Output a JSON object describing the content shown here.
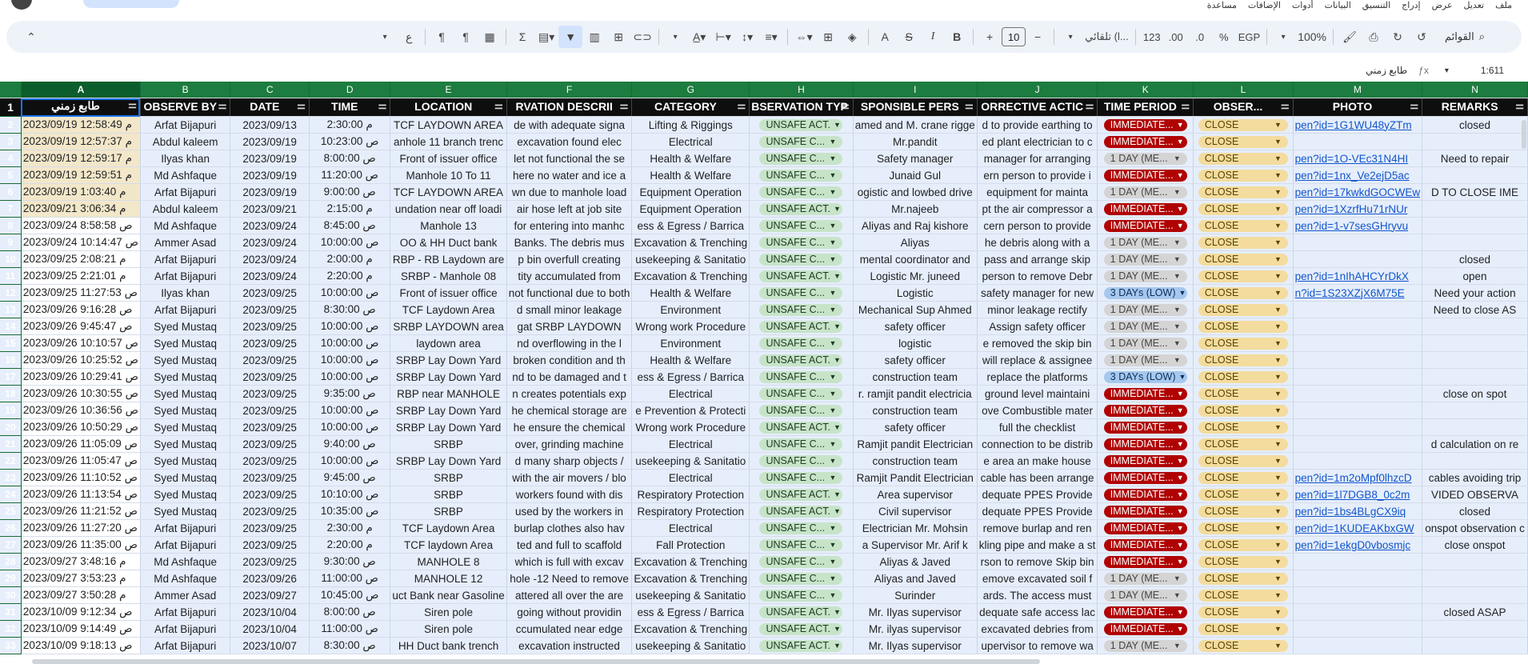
{
  "menu": [
    "ملف",
    "تعديل",
    "عرض",
    "إدراج",
    "التنسيق",
    "البيانات",
    "أدوات",
    "الإضافات",
    "مساعدة"
  ],
  "toolbar": {
    "search": "القوائم",
    "zoom": "100%",
    "currency": "EGP",
    "percent": "%",
    "dec_less": ".0",
    "dec_more": ".00",
    "num_format": "123",
    "font": "تلقائي (l...",
    "font_size": "10"
  },
  "formula_bar": {
    "name_box": "1:611",
    "content": "طابع زمني"
  },
  "columns": [
    "A",
    "B",
    "C",
    "D",
    "E",
    "F",
    "G",
    "H",
    "I",
    "J",
    "K",
    "L",
    "M",
    "N"
  ],
  "headers": [
    "طابع زمني",
    "OBSERVE BY",
    "DATE",
    "TIME",
    "LOCATION",
    "RVATION DESCRII",
    "CATEGORY",
    "BSERVATION TYP",
    "SPONSIBLE PERS",
    "ORRECTIVE ACTIC",
    "TIME PERIOD",
    "OBSER...",
    "PHOTO",
    "REMARKS"
  ],
  "rows": [
    {
      "n": "2",
      "ts": "م 12:58:49 2023/09/19",
      "by": "Arfat Bijapuri",
      "date": "2023/09/13",
      "time": "2:30:00 م",
      "loc": "TCF LAYDOWN AREA",
      "desc": "de with adequate signa",
      "cat": "Lifting & Riggings",
      "type": "UNSAFE ACT.",
      "resp": "amed and M. crane rigge",
      "corr": "d to provide earthing to",
      "period": "IMMEDIATE...",
      "status": "CLOSE",
      "photo": "pen?id=1G1WU48yZTm",
      "rem": "closed"
    },
    {
      "n": "3",
      "ts": "م 12:57:37 2023/09/19",
      "by": "Abdul kaleem",
      "date": "2023/09/19",
      "time": "10:23:00 ص",
      "loc": "anhole 11 branch trenc",
      "desc": "excavation found elec",
      "cat": "Electrical",
      "type": "UNSAFE C...",
      "resp": "Mr.pandit",
      "corr": "ed plant electrician to c",
      "period": "IMMEDIATE...",
      "status": "CLOSE",
      "photo": "",
      "rem": ""
    },
    {
      "n": "4",
      "ts": "م 12:59:17 2023/09/19",
      "by": "Ilyas khan",
      "date": "2023/09/19",
      "time": "8:00:00 ص",
      "loc": "Front of issuer office",
      "desc": "let not functional the se",
      "cat": "Health & Welfare",
      "type": "UNSAFE C...",
      "resp": "Safety manager",
      "corr": "manager for arranging",
      "period": "1 DAY (ME...",
      "status": "CLOSE",
      "photo": "pen?id=1O-VEc31N4HI",
      "rem": "Need to repair"
    },
    {
      "n": "5",
      "ts": "م 12:59:51 2023/09/19",
      "by": "Md Ashfaque",
      "date": "2023/09/19",
      "time": "11:20:00 ص",
      "loc": "Manhole 10 To 11",
      "desc": "here no water and ice a",
      "cat": "Health & Welfare",
      "type": "UNSAFE C...",
      "resp": "Junaid Gul",
      "corr": "ern person to provide i",
      "period": "IMMEDIATE...",
      "status": "CLOSE",
      "photo": "pen?id=1nx_Ve2ejD5ac",
      "rem": ""
    },
    {
      "n": "6",
      "ts": "م 1:03:40 2023/09/19",
      "by": "Arfat Bijapuri",
      "date": "2023/09/19",
      "time": "9:00:00 ص",
      "loc": "TCF LAYDOWN AREA",
      "desc": "wn due to manhole load",
      "cat": "Equipment Operation",
      "type": "UNSAFE C...",
      "resp": "ogistic and lowbed drive",
      "corr": "equipment for mainta",
      "period": "1 DAY (ME...",
      "status": "CLOSE",
      "photo": "pen?id=17kwkdGOCWEw",
      "rem": "D TO CLOSE IME"
    },
    {
      "n": "7",
      "ts": "م 3:06:34 2023/09/21",
      "by": "Abdul kaleem",
      "date": "2023/09/21",
      "time": "2:15:00 م",
      "loc": "undation near off loadi",
      "desc": "air hose left at job site",
      "cat": "Equipment Operation",
      "type": "UNSAFE ACT.",
      "resp": "Mr.najeeb",
      "corr": "pt the air compressor a",
      "period": "IMMEDIATE...",
      "status": "CLOSE",
      "photo": "pen?id=1XzrfHu71rNUr",
      "rem": ""
    },
    {
      "n": "8",
      "ts": "ص 8:58:58 2023/09/24",
      "by": "Md Ashfaque",
      "date": "2023/09/24",
      "time": "8:45:00 ص",
      "loc": "Manhole 13",
      "desc": "for entering into manhc",
      "cat": "ess & Egress / Barrica",
      "type": "UNSAFE C...",
      "resp": "Aliyas and Raj kishore",
      "corr": "cern person to provide",
      "period": "IMMEDIATE...",
      "status": "CLOSE",
      "photo": "pen?id=1-v7sesGHryvu",
      "rem": ""
    },
    {
      "n": "9",
      "ts": "ص 10:14:47 2023/09/24",
      "by": "Ammer Asad",
      "date": "2023/09/24",
      "time": "10:00:00 ص",
      "loc": "OO & HH Duct bank",
      "desc": "Banks. The debris mus",
      "cat": "Excavation & Trenching",
      "type": "UNSAFE C...",
      "resp": "Aliyas",
      "corr": "he debris along with a",
      "period": "1 DAY (ME...",
      "status": "CLOSE",
      "photo": "",
      "rem": ""
    },
    {
      "n": "10",
      "ts": "م 2:08:21 2023/09/25",
      "by": "Arfat Bijapuri",
      "date": "2023/09/24",
      "time": "2:00:00 م",
      "loc": "RBP - RB Laydown are",
      "desc": "p bin overfull creating",
      "cat": "usekeeping & Sanitatio",
      "type": "UNSAFE C...",
      "resp": "mental coordinator and",
      "corr": "pass and arrange skip",
      "period": "1 DAY (ME...",
      "status": "CLOSE",
      "photo": "",
      "rem": "closed"
    },
    {
      "n": "11",
      "ts": "م 2:21:01 2023/09/25",
      "by": "Arfat Bijapuri",
      "date": "2023/09/24",
      "time": "2:20:00 م",
      "loc": "SRBP - Manhole 08",
      "desc": "tity accumulated from",
      "cat": "Excavation & Trenching",
      "type": "UNSAFE ACT.",
      "resp": "Logistic Mr. juneed",
      "corr": "person to remove Debr",
      "period": "1 DAY (ME...",
      "status": "CLOSE",
      "photo": "pen?id=1nIhAHCYrDkX",
      "rem": "open"
    },
    {
      "n": "12",
      "ts": "ص 11:27:53 2023/09/25",
      "by": "Ilyas khan",
      "date": "2023/09/25",
      "time": "10:00:00 ص",
      "loc": "Front of issuer office",
      "desc": "not functional due to both",
      "cat": "Health & Welfare",
      "type": "UNSAFE C...",
      "resp": "Logistic",
      "corr": "safety manager for new",
      "period": "3 DAYs (LOW)",
      "status": "CLOSE",
      "photo": "n?id=1S23XZjX6M75E",
      "rem": "Need your action"
    },
    {
      "n": "13",
      "ts": "ص 9:16:28 2023/09/26",
      "by": "Arfat Bijapuri",
      "date": "2023/09/25",
      "time": "8:30:00 ص",
      "loc": "TCF Laydown Area",
      "desc": "d small minor leakage",
      "cat": "Environment",
      "type": "UNSAFE C...",
      "resp": "Mechanical Sup Ahmed",
      "corr": "minor leakage rectify",
      "period": "1 DAY (ME...",
      "status": "CLOSE",
      "photo": "",
      "rem": "Need to close AS"
    },
    {
      "n": "14",
      "ts": "ص 9:45:47 2023/09/26",
      "by": "Syed Mustaq",
      "date": "2023/09/25",
      "time": "10:00:00 ص",
      "loc": "SRBP LAYDOWN area",
      "desc": "gat SRBP LAYDOWN",
      "cat": "Wrong work Procedure",
      "type": "UNSAFE ACT.",
      "resp": "safety officer",
      "corr": "Assign safety officer",
      "period": "1 DAY (ME...",
      "status": "CLOSE",
      "photo": "",
      "rem": ""
    },
    {
      "n": "15",
      "ts": "ص 10:10:57 2023/09/26",
      "by": "Syed Mustaq",
      "date": "2023/09/25",
      "time": "10:00:00 ص",
      "loc": "laydown area",
      "desc": "nd overflowing in the l",
      "cat": "Environment",
      "type": "UNSAFE C...",
      "resp": "logistic",
      "corr": "e removed the skip bin",
      "period": "1 DAY (ME...",
      "status": "CLOSE",
      "photo": "",
      "rem": ""
    },
    {
      "n": "16",
      "ts": "ص 10:25:52 2023/09/26",
      "by": "Syed Mustaq",
      "date": "2023/09/25",
      "time": "10:00:00 ص",
      "loc": "SRBP Lay Down Yard",
      "desc": "broken condition and th",
      "cat": "Health & Welfare",
      "type": "UNSAFE ACT.",
      "resp": "safety officer",
      "corr": "will replace & assignee",
      "period": "1 DAY (ME...",
      "status": "CLOSE",
      "photo": "",
      "rem": ""
    },
    {
      "n": "17",
      "ts": "ص 10:29:41 2023/09/26",
      "by": "Syed Mustaq",
      "date": "2023/09/25",
      "time": "10:00:00 ص",
      "loc": "SRBP Lay Down Yard",
      "desc": "nd to be damaged and t",
      "cat": "ess & Egress / Barrica",
      "type": "UNSAFE C...",
      "resp": "construction team",
      "corr": "replace the platforms",
      "period": "3 DAYs (LOW)",
      "status": "CLOSE",
      "photo": "",
      "rem": ""
    },
    {
      "n": "18",
      "ts": "ص 10:30:55 2023/09/26",
      "by": "Syed Mustaq",
      "date": "2023/09/25",
      "time": "9:35:00 ص",
      "loc": "RBP near MANHOLE",
      "desc": "n creates potentials exp",
      "cat": "Electrical",
      "type": "UNSAFE C...",
      "resp": "r. ramjit pandit electricia",
      "corr": "ground level maintaini",
      "period": "IMMEDIATE...",
      "status": "CLOSE",
      "photo": "",
      "rem": "close on spot"
    },
    {
      "n": "19",
      "ts": "ص 10:36:56 2023/09/26",
      "by": "Syed Mustaq",
      "date": "2023/09/25",
      "time": "10:00:00 ص",
      "loc": "SRBP Lay Down Yard",
      "desc": "he chemical storage are",
      "cat": "e Prevention & Protecti",
      "type": "UNSAFE C...",
      "resp": "construction team",
      "corr": "ove Combustible mater",
      "period": "IMMEDIATE...",
      "status": "CLOSE",
      "photo": "",
      "rem": ""
    },
    {
      "n": "20",
      "ts": "ص 10:50:29 2023/09/26",
      "by": "Syed Mustaq",
      "date": "2023/09/25",
      "time": "10:00:00 ص",
      "loc": "SRBP Lay Down Yard",
      "desc": "he ensure the chemical",
      "cat": "Wrong work Procedure",
      "type": "UNSAFE ACT.",
      "resp": "safety officer",
      "corr": "full the checklist",
      "period": "IMMEDIATE...",
      "status": "CLOSE",
      "photo": "",
      "rem": ""
    },
    {
      "n": "21",
      "ts": "ص 11:05:09 2023/09/26",
      "by": "Syed Mustaq",
      "date": "2023/09/25",
      "time": "9:40:00 ص",
      "loc": "SRBP",
      "desc": "over, grinding machine",
      "cat": "Electrical",
      "type": "UNSAFE C...",
      "resp": "Ramjit pandit Electrician",
      "corr": "connection to be distrib",
      "period": "IMMEDIATE...",
      "status": "CLOSE",
      "photo": "",
      "rem": "d calculation on re"
    },
    {
      "n": "22",
      "ts": "ص 11:05:47 2023/09/26",
      "by": "Syed Mustaq",
      "date": "2023/09/25",
      "time": "10:00:00 ص",
      "loc": "SRBP Lay Down Yard",
      "desc": "d many sharp objects /",
      "cat": "usekeeping & Sanitatio",
      "type": "UNSAFE C...",
      "resp": "construction team",
      "corr": "e area an make house",
      "period": "IMMEDIATE...",
      "status": "CLOSE",
      "photo": "",
      "rem": ""
    },
    {
      "n": "23",
      "ts": "ص 11:10:52 2023/09/26",
      "by": "Syed Mustaq",
      "date": "2023/09/25",
      "time": "9:45:00 ص",
      "loc": "SRBP",
      "desc": "with the air movers / blo",
      "cat": "Electrical",
      "type": "UNSAFE C...",
      "resp": "Ramjit Pandit Electrician",
      "corr": "cable has been arrange",
      "period": "IMMEDIATE...",
      "status": "CLOSE",
      "photo": "pen?id=1m2oMpf0lhzcD",
      "rem": "cables avoiding trip"
    },
    {
      "n": "24",
      "ts": "ص 11:13:54 2023/09/26",
      "by": "Syed Mustaq",
      "date": "2023/09/25",
      "time": "10:10:00 ص",
      "loc": "SRBP",
      "desc": "workers found with dis",
      "cat": "Respiratory Protection",
      "type": "UNSAFE ACT.",
      "resp": "Area supervisor",
      "corr": "dequate PPES Provide",
      "period": "IMMEDIATE...",
      "status": "CLOSE",
      "photo": "pen?id=1l7DGB8_0c2m",
      "rem": "VIDED OBSERVA"
    },
    {
      "n": "25",
      "ts": "ص 11:21:52 2023/09/26",
      "by": "Syed Mustaq",
      "date": "2023/09/25",
      "time": "10:35:00 ص",
      "loc": "SRBP",
      "desc": "used by the workers in",
      "cat": "Respiratory Protection",
      "type": "UNSAFE ACT.",
      "resp": "Civil supervisor",
      "corr": "dequate PPES Provide",
      "period": "IMMEDIATE...",
      "status": "CLOSE",
      "photo": "pen?id=1bs4BLgCX9iq",
      "rem": "closed"
    },
    {
      "n": "26",
      "ts": "ص 11:27:20 2023/09/26",
      "by": "Arfat Bijapuri",
      "date": "2023/09/25",
      "time": "2:30:00 م",
      "loc": "TCF Laydown Area",
      "desc": "burlap clothes also hav",
      "cat": "Electrical",
      "type": "UNSAFE C...",
      "resp": "Electrician Mr. Mohsin",
      "corr": "remove burlap and ren",
      "period": "IMMEDIATE...",
      "status": "CLOSE",
      "photo": "pen?id=1KUDEAKbxGW",
      "rem": "onspot observation c"
    },
    {
      "n": "27",
      "ts": "ص 11:35:00 2023/09/26",
      "by": "Arfat Bijapuri",
      "date": "2023/09/25",
      "time": "2:20:00 م",
      "loc": "TCF laydown Area",
      "desc": "ted and full to scaffold",
      "cat": "Fall Protection",
      "type": "UNSAFE C...",
      "resp": "a Supervisor Mr. Arif k",
      "corr": "kling pipe and make a st",
      "period": "IMMEDIATE...",
      "status": "CLOSE",
      "photo": "pen?id=1ekgD0vbosmjc",
      "rem": "close onspot"
    },
    {
      "n": "28",
      "ts": "م 3:48:16 2023/09/27",
      "by": "Md Ashfaque",
      "date": "2023/09/25",
      "time": "9:30:00 ص",
      "loc": "MANHOLE 8",
      "desc": "which is full with excav",
      "cat": "Excavation & Trenching",
      "type": "UNSAFE C...",
      "resp": "Aliyas & Javed",
      "corr": "rson to remove Skip bin",
      "period": "IMMEDIATE...",
      "status": "CLOSE",
      "photo": "",
      "rem": ""
    },
    {
      "n": "29",
      "ts": "م 3:53:23 2023/09/27",
      "by": "Md Ashfaque",
      "date": "2023/09/26",
      "time": "11:00:00 ص",
      "loc": "MANHOLE 12",
      "desc": "hole -12 Need to remove",
      "cat": "Excavation & Trenching",
      "type": "UNSAFE C...",
      "resp": "Aliyas and Javed",
      "corr": "emove excavated soil f",
      "period": "1 DAY (ME...",
      "status": "CLOSE",
      "photo": "",
      "rem": ""
    },
    {
      "n": "30",
      "ts": "م 3:50:28 2023/09/27",
      "by": "Ammer Asad",
      "date": "2023/09/27",
      "time": "10:45:00 ص",
      "loc": "uct Bank near Gasoline",
      "desc": "attered all over the are",
      "cat": "usekeeping & Sanitatio",
      "type": "UNSAFE C...",
      "resp": "Surinder",
      "corr": "ards. The access must",
      "period": "1 DAY (ME...",
      "status": "CLOSE",
      "photo": "",
      "rem": ""
    },
    {
      "n": "31",
      "ts": "ص 9:12:34 2023/10/09",
      "by": "Arfat Bijapuri",
      "date": "2023/10/04",
      "time": "8:00:00 ص",
      "loc": "Siren pole",
      "desc": "going without providin",
      "cat": "ess & Egress / Barrica",
      "type": "UNSAFE ACT.",
      "resp": "Mr. Ilyas supervisor",
      "corr": "dequate safe access lac",
      "period": "IMMEDIATE...",
      "status": "CLOSE",
      "photo": "",
      "rem": "closed ASAP"
    },
    {
      "n": "32",
      "ts": "ص 9:14:49 2023/10/09",
      "by": "Arfat Bijapuri",
      "date": "2023/10/04",
      "time": "11:00:00 ص",
      "loc": "Siren pole",
      "desc": "ccumulated near edge",
      "cat": "Excavation & Trenching",
      "type": "UNSAFE ACT.",
      "resp": "Mr. ilyas supervisor",
      "corr": "excavated debries from",
      "period": "IMMEDIATE...",
      "status": "CLOSE",
      "photo": "",
      "rem": ""
    },
    {
      "n": "33",
      "ts": "ص 9:18:13 2023/10/09",
      "by": "Arfat Bijapuri",
      "date": "2023/10/07",
      "time": "8:30:00 ص",
      "loc": "HH Duct bank trench",
      "desc": "excavation instructed",
      "cat": "usekeeping & Sanitatio",
      "type": "UNSAFE ACT.",
      "resp": "Mr. Ilyas supervisor",
      "corr": "upervisor to remove wa",
      "period": "1 DAY (ME...",
      "status": "CLOSE",
      "photo": "",
      "rem": ""
    }
  ],
  "colors": {
    "header_green": "#1d7c3f",
    "immediate": "#b10202",
    "unsafe": "#c7e4c9",
    "close": "#f3dc9e",
    "low": "#a6c8ee",
    "row_bg": "#e6eefb"
  }
}
